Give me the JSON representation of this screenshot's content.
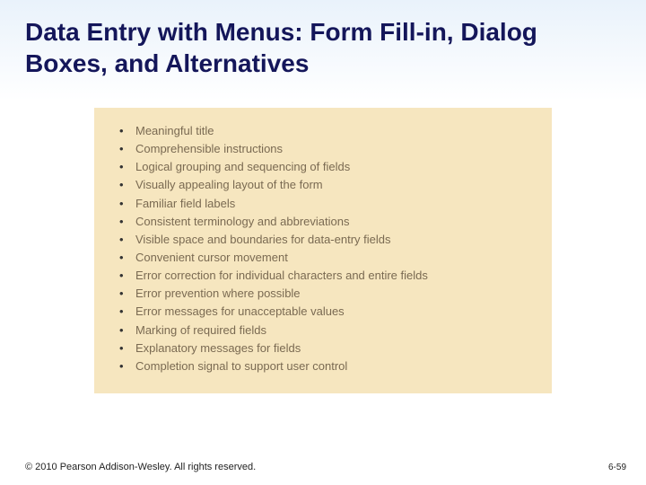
{
  "header": {
    "title": "Data Entry with Menus: Form Fill-in, Dialog Boxes, and Alternatives"
  },
  "bullets": [
    "Meaningful title",
    "Comprehensible instructions",
    "Logical grouping and sequencing of fields",
    "Visually appealing layout of the form",
    "Familiar field labels",
    "Consistent terminology and abbreviations",
    "Visible space and boundaries for data-entry fields",
    "Convenient cursor movement",
    "Error correction for individual characters and entire fields",
    "Error prevention where possible",
    "Error messages for unacceptable values",
    "Marking of required fields",
    "Explanatory messages for fields",
    "Completion signal to support user control"
  ],
  "footer": {
    "copyright": "© 2010 Pearson Addison-Wesley. All rights reserved.",
    "page": "6-59"
  }
}
